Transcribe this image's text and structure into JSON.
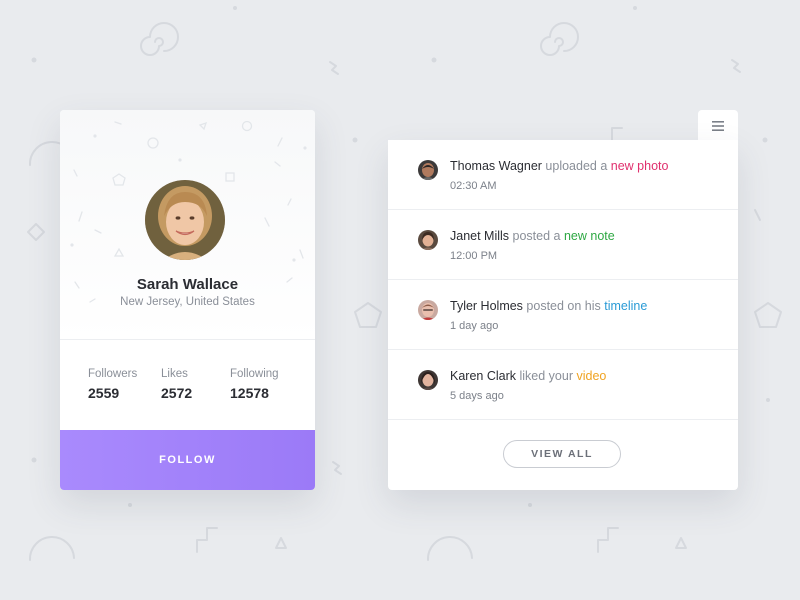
{
  "profile": {
    "name": "Sarah Wallace",
    "location": "New Jersey, United States",
    "stats": [
      {
        "label": "Followers",
        "value": "2559"
      },
      {
        "label": "Likes",
        "value": "2572"
      },
      {
        "label": "Following",
        "value": "12578"
      }
    ],
    "follow_label": "FOLLOW"
  },
  "activity": {
    "items": [
      {
        "user": "Thomas Wagner",
        "action": "uploaded a",
        "object": "new photo",
        "object_color": "#e0306e",
        "time": "02:30 AM"
      },
      {
        "user": "Janet Mills",
        "action": "posted a",
        "object": "new note",
        "object_color": "#2ea843",
        "time": "12:00 PM"
      },
      {
        "user": "Tyler Holmes",
        "action": "posted on his",
        "object": "timeline",
        "object_color": "#2a9bd6",
        "time": "1 day ago"
      },
      {
        "user": "Karen Clark",
        "action": "liked your",
        "object": "video",
        "object_color": "#f0a321",
        "time": "5 days ago"
      }
    ],
    "view_all_label": "VIEW ALL",
    "menu_icon": "hamburger-menu-icon"
  },
  "colors": {
    "follow_button": "#a58af9",
    "background": "#e9ebee"
  }
}
